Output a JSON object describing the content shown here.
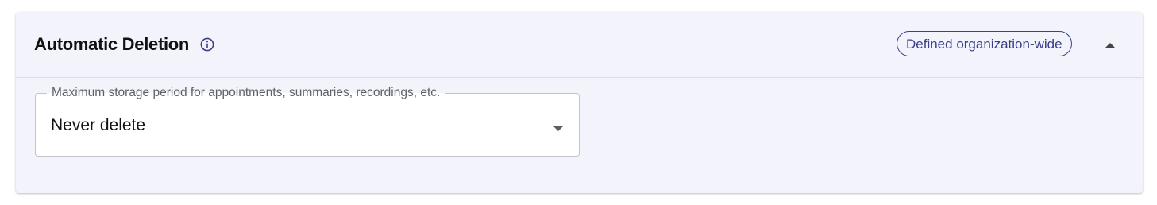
{
  "section": {
    "title": "Automatic Deletion",
    "info_icon": "info-circle-icon",
    "badge": "Defined organization-wide",
    "collapse_icon": "caret-up-icon"
  },
  "storage_field": {
    "label": "Maximum storage period for appointments, summaries, recordings, etc.",
    "value": "Never delete",
    "dropdown_icon": "caret-down-icon"
  },
  "colors": {
    "panel_background": "#f3f4fb",
    "badge_accent": "#3a3f8c",
    "text_primary": "#111111",
    "text_secondary": "#5f6068"
  }
}
